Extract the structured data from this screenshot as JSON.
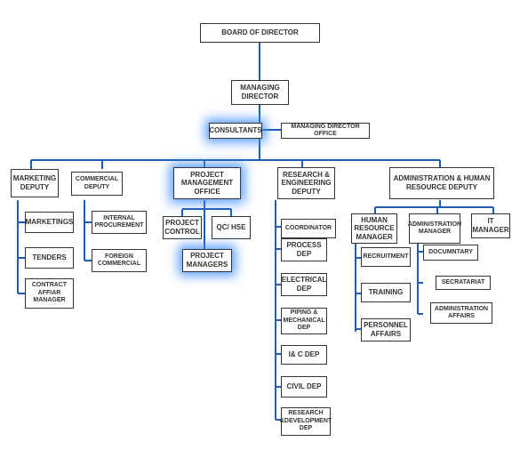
{
  "chart_data": {
    "type": "org-chart",
    "root": "BOARD OF DIRECTOR",
    "nodes": [
      {
        "id": "board",
        "label": "BOARD OF DIRECTOR",
        "parent": null
      },
      {
        "id": "md",
        "label": "MANAGING DIRECTOR",
        "parent": "board"
      },
      {
        "id": "consultants",
        "label": "CONSULTANTS",
        "parent": "md",
        "highlight": true
      },
      {
        "id": "mdo",
        "label": "MANAGING  DIRECTOR  OFFICE",
        "parent": "md"
      },
      {
        "id": "mkt_dep",
        "label": "MARKETING DEPUTY",
        "parent": "md"
      },
      {
        "id": "com_dep",
        "label": "COMMERCIAL DEPUTY",
        "parent": "md"
      },
      {
        "id": "pmo",
        "label": "PROJECT MANAGEMENT OFFICE",
        "parent": "md",
        "highlight": true
      },
      {
        "id": "re_dep",
        "label": "RESEARCH & ENGINEERING DEPUTY",
        "parent": "md"
      },
      {
        "id": "ahr_dep",
        "label": "ADMINISTRATION & HUMAN RESOURCE DEPUTY",
        "parent": "md"
      },
      {
        "id": "marketings",
        "label": "MARKETINGS",
        "parent": "mkt_dep"
      },
      {
        "id": "tenders",
        "label": "TENDERS",
        "parent": "mkt_dep"
      },
      {
        "id": "cam",
        "label": "CONTRACT AFFIAR MANAGER",
        "parent": "mkt_dep"
      },
      {
        "id": "intproc",
        "label": "INTERNAL PROCUREMENT",
        "parent": "com_dep"
      },
      {
        "id": "forcom",
        "label": "FOREIGN COMMERCIAL",
        "parent": "com_dep"
      },
      {
        "id": "pcontrol",
        "label": "PROJECT CONTROL",
        "parent": "pmo"
      },
      {
        "id": "qchse",
        "label": "QC/ HSE",
        "parent": "pmo"
      },
      {
        "id": "pm",
        "label": "PROJECT MANAGERS",
        "parent": "pmo",
        "highlight": true
      },
      {
        "id": "coord",
        "label": "COORDINATOR",
        "parent": "re_dep"
      },
      {
        "id": "process",
        "label": "PROCESS DEP",
        "parent": "re_dep"
      },
      {
        "id": "elec",
        "label": "ELECTRICAL DEP",
        "parent": "re_dep"
      },
      {
        "id": "piping",
        "label": "PIPING & MECHANICAL DEP",
        "parent": "re_dep"
      },
      {
        "id": "ic",
        "label": "I& C DEP",
        "parent": "re_dep"
      },
      {
        "id": "civil",
        "label": "CIVIL DEP",
        "parent": "re_dep"
      },
      {
        "id": "rnd",
        "label": "RESEARCH &DEVELOPMENT DEP",
        "parent": "re_dep"
      },
      {
        "id": "hrm",
        "label": "HUMAN RESOURCE MANAGER",
        "parent": "ahr_dep"
      },
      {
        "id": "adm",
        "label": "ADMINISTRATION MANAGER",
        "parent": "ahr_dep"
      },
      {
        "id": "itm",
        "label": "IT MANAGER",
        "parent": "ahr_dep"
      },
      {
        "id": "recruit",
        "label": "RECRUITMENT",
        "parent": "hrm"
      },
      {
        "id": "training",
        "label": "TRAINING",
        "parent": "hrm"
      },
      {
        "id": "paffairs",
        "label": "PERSONNEL AFFAIRS",
        "parent": "hrm"
      },
      {
        "id": "doc",
        "label": "DOCUMNTARY",
        "parent": "adm"
      },
      {
        "id": "secr",
        "label": "SECRATARIAT",
        "parent": "adm"
      },
      {
        "id": "aaffairs",
        "label": "ADMINISTRATION AFFAIRS",
        "parent": "adm"
      }
    ]
  },
  "labels": {
    "board": "BOARD OF DIRECTOR",
    "md": "MANAGING DIRECTOR",
    "consultants": "CONSULTANTS",
    "mdo": "MANAGING  DIRECTOR  OFFICE",
    "mkt_dep": "MARKETING DEPUTY",
    "com_dep": "COMMERCIAL DEPUTY",
    "pmo": "PROJECT MANAGEMENT OFFICE",
    "re_dep": "RESEARCH & ENGINEERING DEPUTY",
    "ahr_dep": "ADMINISTRATION & HUMAN RESOURCE DEPUTY",
    "marketings": "MARKETINGS",
    "tenders": "TENDERS",
    "cam": "CONTRACT AFFIAR MANAGER",
    "intproc": "INTERNAL PROCUREMENT",
    "forcom": "FOREIGN COMMERCIAL",
    "pcontrol": "PROJECT CONTROL",
    "qchse": "QC/ HSE",
    "pm": "PROJECT MANAGERS",
    "coord": "COORDINATOR",
    "process": "PROCESS DEP",
    "elec": "ELECTRICAL DEP",
    "piping": "PIPING & MECHANICAL DEP",
    "ic": "I& C DEP",
    "civil": "CIVIL DEP",
    "rnd": "RESEARCH &DEVELOPMENT DEP",
    "hrm": "HUMAN RESOURCE MANAGER",
    "adm": "ADMINISTRATION MANAGER",
    "itm": "IT MANAGER",
    "recruit": "RECRUITMENT",
    "training": "TRAINING",
    "paffairs": "PERSONNEL AFFAIRS",
    "doc": "DOCUMNTARY",
    "secr": "SECRATARIAT",
    "aaffairs": "ADMINISTRATION AFFAIRS"
  }
}
